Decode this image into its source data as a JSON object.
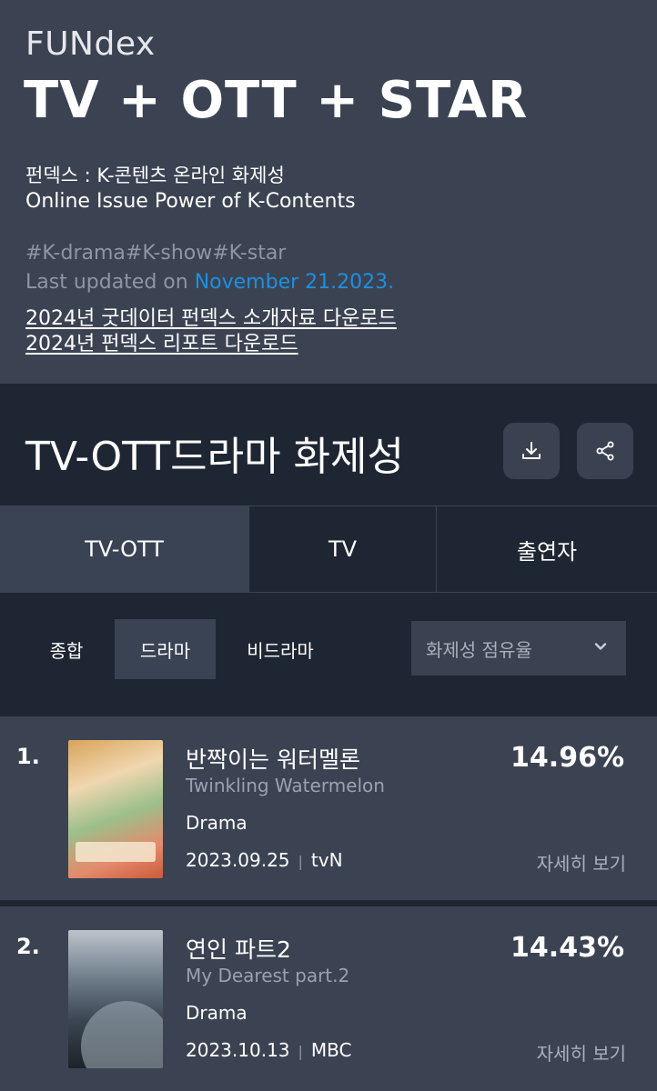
{
  "header": {
    "brand": "FUNdex",
    "headline": "TV + OTT + STAR",
    "subtitle_ko": "펀덱스 : K-콘텐츠 온라인 화제성",
    "subtitle_en": "Online Issue Power of K-Contents",
    "hashtags": "#K-drama#K-show#K-star",
    "updated_prefix": "Last updated on ",
    "updated_date": "November 21.2023.",
    "download_link_1": "2024년 굿데이터 펀덱스 소개자료 다운로드",
    "download_link_2": "2024년 펀덱스 리포트 다운로드"
  },
  "section": {
    "title": "TV-OTT드라마 화제성",
    "download_icon": "download-icon",
    "share_icon": "share-icon"
  },
  "tabs": [
    {
      "label": "TV-OTT",
      "active": true
    },
    {
      "label": "TV",
      "active": false
    },
    {
      "label": "출연자",
      "active": false
    }
  ],
  "filters": [
    {
      "label": "종합",
      "active": false
    },
    {
      "label": "드라마",
      "active": true
    },
    {
      "label": "비드라마",
      "active": false
    }
  ],
  "sort_select": {
    "value": "화제성 점유율",
    "icon": "chevron-down-icon"
  },
  "colors": {
    "accent_link": "#1e8fe0",
    "header_bg": "#3b4353",
    "page_bg": "#1f2633"
  },
  "items": [
    {
      "rank": "1.",
      "title_ko": "반짝이는 워터멜론",
      "title_en": "Twinkling Watermelon",
      "genre": "Drama",
      "date": "2023.09.25",
      "channel": "tvN",
      "share": "14.96%",
      "detail_label": "자세히 보기"
    },
    {
      "rank": "2.",
      "title_ko": "연인 파트2",
      "title_en": "My Dearest part.2",
      "genre": "Drama",
      "date": "2023.10.13",
      "channel": "MBC",
      "share": "14.43%",
      "detail_label": "자세히 보기"
    }
  ]
}
